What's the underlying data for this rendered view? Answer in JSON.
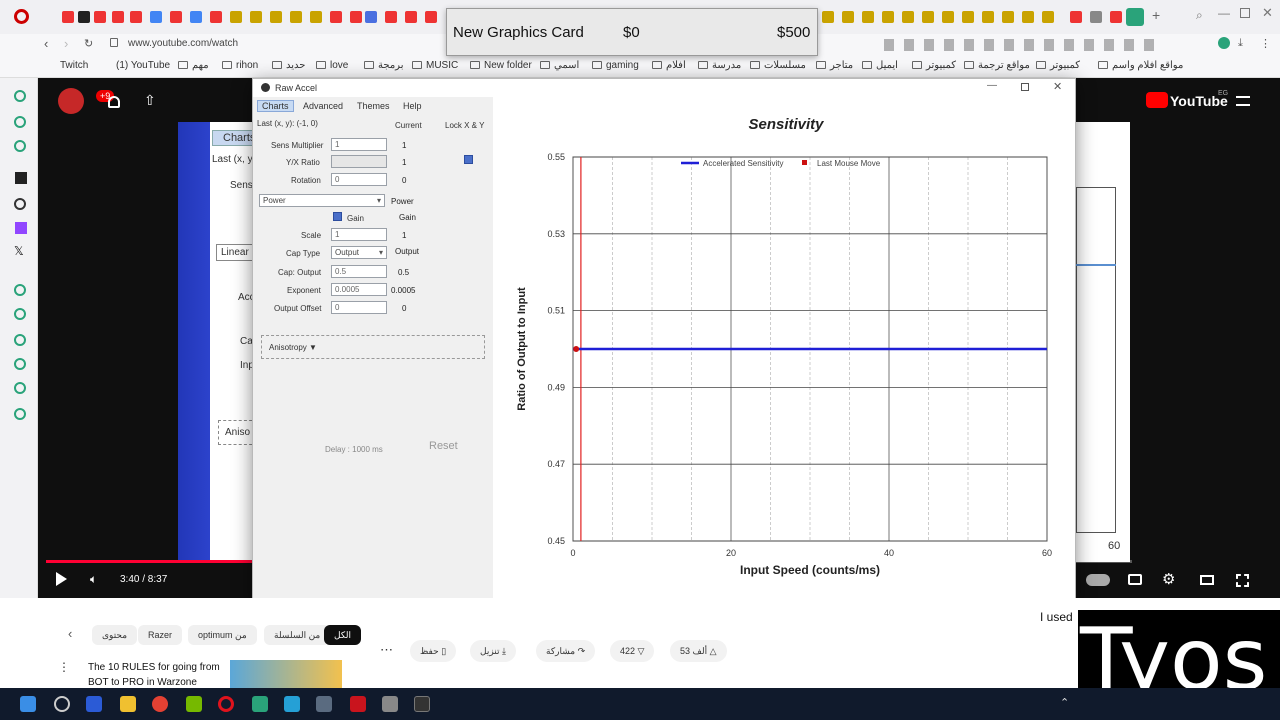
{
  "browser": {
    "url": "www.youtube.com/watch",
    "bookmarks": [
      "Twitch",
      "(1) YouTube",
      "مهم",
      "rihon",
      "حديد",
      "love",
      "برمجة",
      "MUSIC",
      "New folder",
      "اسمي",
      "gaming",
      "افلام",
      "مدرسة",
      "مسلسلات",
      "متاجر",
      "ايميل",
      "كمبيوتر",
      "مواقع ترجمة",
      "كمبيوتر",
      "مواقع افلام واسم"
    ]
  },
  "popup": {
    "item": "New Graphics Card",
    "current": "$0",
    "target": "$500"
  },
  "youtube": {
    "brand": "YouTube",
    "region": "EG",
    "notif_count": "+9",
    "time": "3:40 / 8:37",
    "progress_fraction": 0.43,
    "chips": [
      "الكل",
      "من السلسلة",
      "optimum من",
      "Razer",
      "محتوى"
    ],
    "actions": {
      "like": "53 ألف",
      "dislike": "422",
      "share": "مشاركة",
      "download": "تنزيل",
      "save": "حفظ"
    },
    "rec_title": "The 10 RULES for going from",
    "rec_sub": "BOT to PRO in Warzone",
    "comment_snip": "I used",
    "bg_labels": {
      "charts": "Charts",
      "last": "Last (x, y",
      "sens": "Sens",
      "linear": "Linear",
      "aniso": "Aniso",
      "acc": "Acc",
      "ca": "Ca",
      "inp": "Inp",
      "six": "60"
    }
  },
  "overlay_text": "Tyos",
  "rawaccel": {
    "title": "Raw Accel",
    "menu": [
      "Charts",
      "Advanced",
      "Themes",
      "Help"
    ],
    "last_xy": "Last (x, y): (-1, 0)",
    "col_current": "Current",
    "col_lock": "Lock X & Y",
    "fields": [
      {
        "label": "Sens Multiplier",
        "input": "1",
        "current": "1"
      },
      {
        "label": "Y/X Ratio",
        "input": "",
        "current": "1"
      },
      {
        "label": "Rotation",
        "input": "0",
        "current": "0"
      }
    ],
    "mode_select": "Power",
    "mode_current": "Power",
    "gain_label": "Gain",
    "gain_current": "Gain",
    "fields2": [
      {
        "label": "Scale",
        "input": "1",
        "current": "1"
      },
      {
        "label": "Cap Type",
        "input": "Output",
        "current": "Output"
      },
      {
        "label": "Cap: Output",
        "input": "0.5",
        "current": "0.5"
      },
      {
        "label": "Exponent",
        "input": "0.0005",
        "current": "0.0005"
      },
      {
        "label": "Output Offset",
        "input": "0",
        "current": "0"
      }
    ],
    "anisotropy": "Anisotropy ▼",
    "delay": "Delay : 1000 ms",
    "reset": "Reset"
  },
  "chart_data": {
    "type": "line",
    "title": "Sensitivity",
    "xlabel": "Input Speed (counts/ms)",
    "ylabel": "Ratio of Output to Input",
    "xlim": [
      0,
      60
    ],
    "ylim": [
      0.45,
      0.55
    ],
    "xticks": [
      0,
      20,
      40,
      60
    ],
    "yticks": [
      0.45,
      0.47,
      0.49,
      0.51,
      0.53,
      0.55
    ],
    "ytick_labels": [
      "0.45",
      "0.47",
      "0.49",
      "0.51",
      "0.53",
      "0.55"
    ],
    "series": [
      {
        "name": "Accelerated Sensitivity",
        "color": "#1f1fd6",
        "x": [
          0,
          60
        ],
        "y": [
          0.5,
          0.5
        ]
      },
      {
        "name": "Last Mouse Move",
        "color": "#cc1111",
        "type": "marker",
        "x": [
          0.4
        ],
        "y": [
          0.5
        ]
      }
    ],
    "vline_x": 1.0,
    "legend": "top"
  }
}
